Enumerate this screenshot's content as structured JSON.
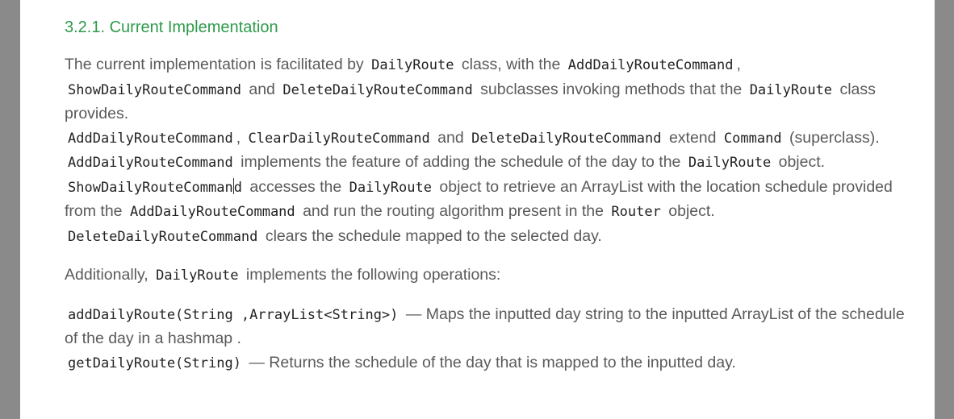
{
  "heading": "3.2.1. Current Implementation",
  "para1": {
    "s1_t1": "The current implementation is facilitated by",
    "s1_c1": "DailyRoute",
    "s1_t2": "class, with the",
    "s1_c2": "AddDailyRouteCommand",
    "s1_t3": ",",
    "s1_c3": "ShowDailyRouteCommand",
    "s1_t4": "and",
    "s1_c4": "DeleteDailyRouteCommand",
    "s1_t5": "subclasses invoking methods that the",
    "s1_c5": "DailyRoute",
    "s1_t6": "class provides.",
    "s2_c1": "AddDailyRouteCommand",
    "s2_t1": ",",
    "s2_c2": "ClearDailyRouteCommand",
    "s2_t2": "and",
    "s2_c3": "DeleteDailyRouteCommand",
    "s2_t3": "extend",
    "s2_c4": "Command",
    "s2_t4": "(superclass).",
    "s3_c1": "AddDailyRouteCommand",
    "s3_t1": "implements the feature of adding the schedule of the day to the",
    "s3_c2": "DailyRoute",
    "s3_t2": "object.",
    "s4_c1a": "ShowDailyRouteComman",
    "s4_c1b": "d",
    "s4_t1": "accesses the",
    "s4_c2": "DailyRoute",
    "s4_t2": "object to retrieve an ArrayList with the location schedule provided from the",
    "s4_c3": "AddDailyRouteCommand",
    "s4_t3": "and run the routing algorithm present in the",
    "s4_c4": "Router",
    "s4_t4": "object.",
    "s5_c1": "DeleteDailyRouteCommand",
    "s5_t1": "clears the schedule mapped to the selected day."
  },
  "para2": {
    "t1": "Additionally,",
    "c1": "DailyRoute",
    "t2": "implements the following operations:"
  },
  "para3": {
    "op1_code": "addDailyRoute(String ,ArrayList<String>)",
    "op1_desc": "— Maps the inputted day string to the inputted ArrayList of the schedule of the day in a hashmap .",
    "op2_code": "getDailyRoute(String)",
    "op2_desc": "— Returns the schedule of the day that is mapped to the inputted day."
  }
}
